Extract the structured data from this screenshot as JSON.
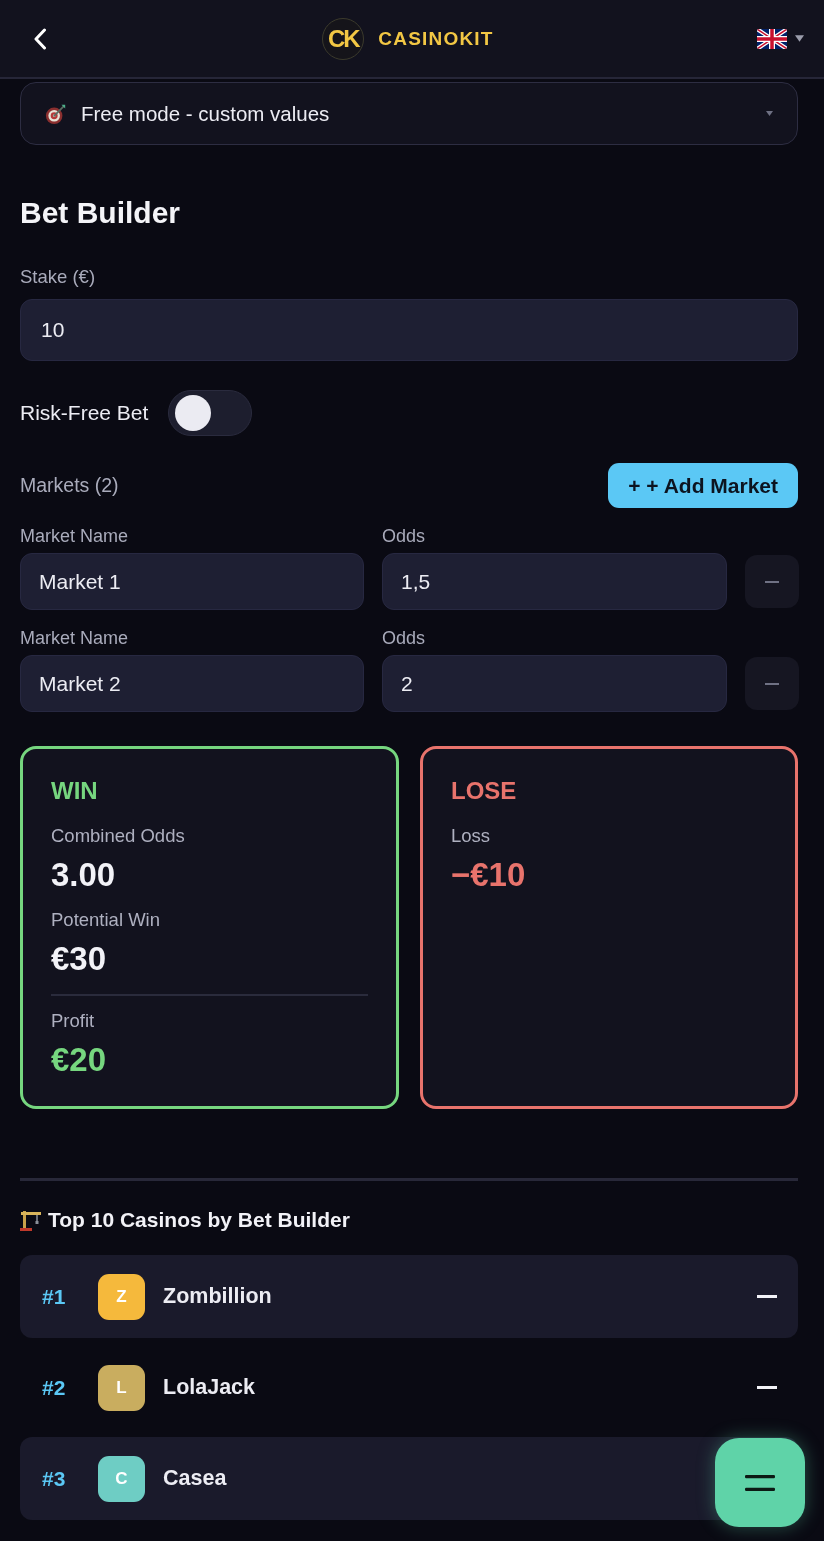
{
  "header": {
    "logo_mark": "CK",
    "brand": "CASINOKIT"
  },
  "mode_select": {
    "value": "Free mode - custom values"
  },
  "title": "Bet Builder",
  "stake": {
    "label": "Stake (€)",
    "value": "10"
  },
  "risk_free": {
    "label": "Risk-Free Bet",
    "on": false
  },
  "markets": {
    "label": "Markets (2)",
    "add_button": "+ + Add Market",
    "items": [
      {
        "name_label": "Market Name",
        "name": "Market 1",
        "odds_label": "Odds",
        "odds": "1,5"
      },
      {
        "name_label": "Market Name",
        "name": "Market 2",
        "odds_label": "Odds",
        "odds": "2"
      }
    ]
  },
  "outcomes": [
    {
      "kind": "win",
      "title": "WIN",
      "stats": [
        {
          "kind": "metric",
          "label": "Combined Odds",
          "value": "3.00"
        },
        {
          "kind": "metric",
          "label": "Potential Win",
          "value": "€30"
        },
        {
          "kind": "net",
          "label": "Profit",
          "value": "€20"
        }
      ]
    },
    {
      "kind": "lose",
      "title": "LOSE",
      "stats": [
        {
          "kind": "result",
          "label": "Loss",
          "value": "−€10"
        }
      ]
    }
  ],
  "ranking": {
    "title": "Top 10 Casinos by Bet Builder",
    "casinos": [
      {
        "rank": "#1",
        "initial": "Z",
        "name": "Zombillion",
        "color": "#f5b93c"
      },
      {
        "rank": "#2",
        "initial": "L",
        "name": "LolaJack",
        "color": "#c9ad5f"
      },
      {
        "rank": "#3",
        "initial": "C",
        "name": "Casea",
        "color": "#6ecdc4"
      }
    ]
  }
}
